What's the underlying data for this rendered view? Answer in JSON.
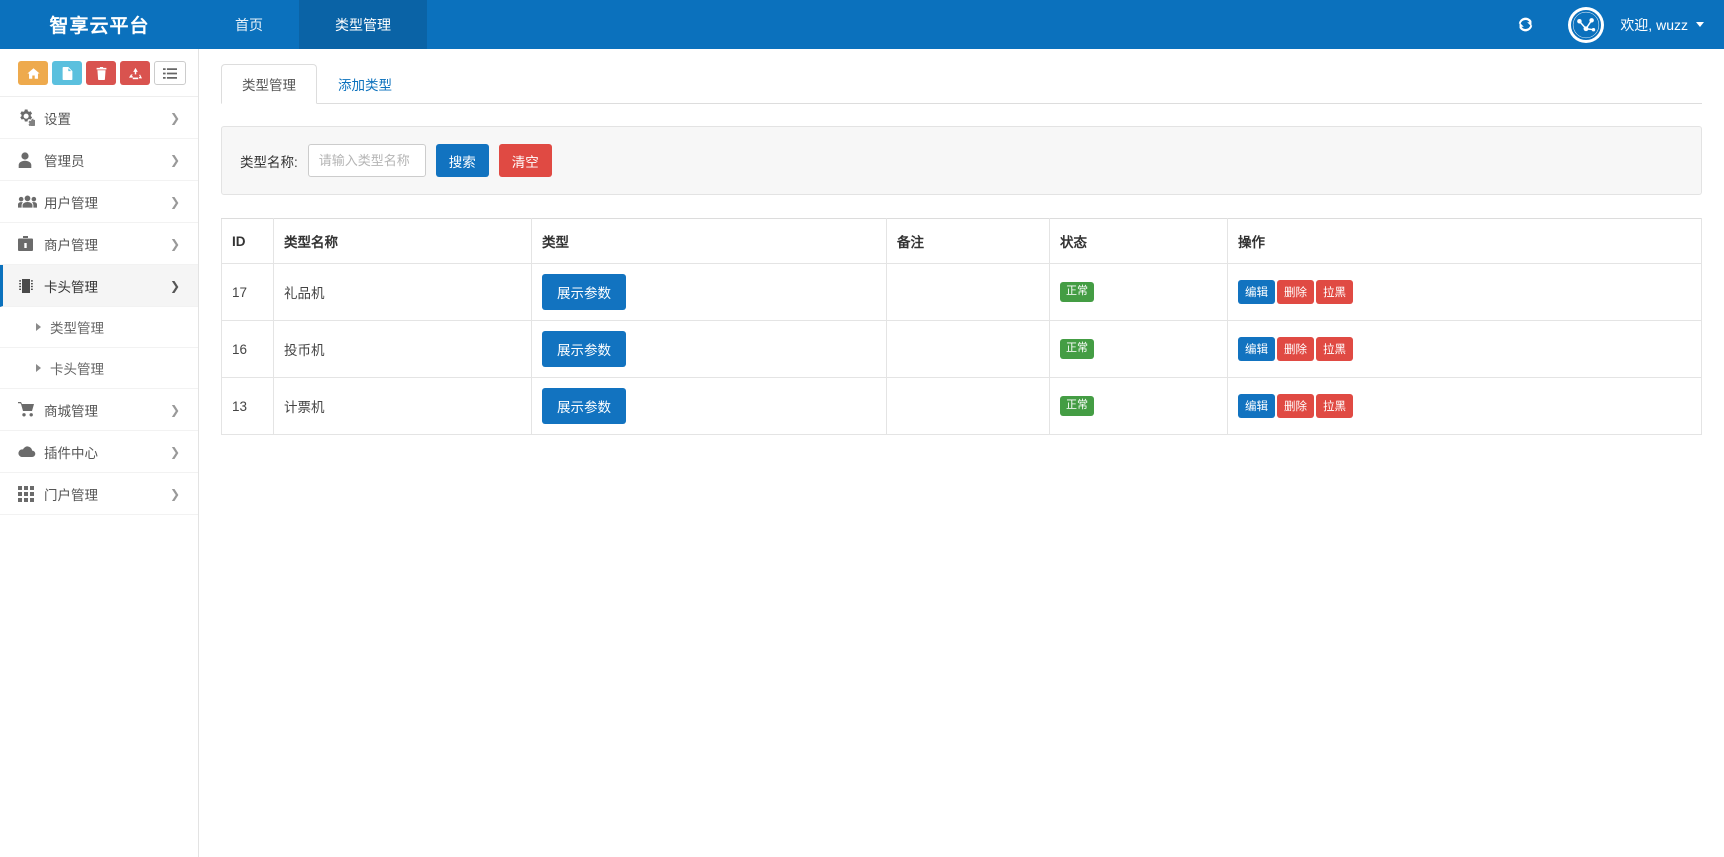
{
  "navbar": {
    "brand": "智享云平台",
    "links": [
      {
        "label": "首页",
        "active": false
      },
      {
        "label": "类型管理",
        "active": true
      }
    ],
    "refresh_icon": "refresh-icon",
    "avatar_icon": "network-globe-icon",
    "welcome": "欢迎, wuzz",
    "accent_color": "#0b71bd",
    "accent_active_color": "#0a63a6"
  },
  "sidebar": {
    "toolbar": [
      {
        "icon": "home-icon",
        "color": "#eeaa4d"
      },
      {
        "icon": "file-icon",
        "color": "#5bc0de"
      },
      {
        "icon": "trash-icon",
        "color": "#d9534f"
      },
      {
        "icon": "recycle-icon",
        "color": "#d9534f"
      },
      {
        "icon": "list-icon",
        "color": "#ffffff"
      }
    ],
    "items": [
      {
        "label": "设置",
        "icon": "gears-icon",
        "active": false
      },
      {
        "label": "管理员",
        "icon": "user-icon",
        "active": false
      },
      {
        "label": "用户管理",
        "icon": "users-icon",
        "active": false
      },
      {
        "label": "商户管理",
        "icon": "briefcase-icon",
        "active": false
      },
      {
        "label": "卡头管理",
        "icon": "chip-icon",
        "active": true
      }
    ],
    "submenu": [
      {
        "label": "类型管理"
      },
      {
        "label": "卡头管理"
      }
    ],
    "items_after": [
      {
        "label": "商城管理",
        "icon": "cart-icon",
        "active": false
      },
      {
        "label": "插件中心",
        "icon": "cloud-icon",
        "active": false
      },
      {
        "label": "门户管理",
        "icon": "grid-icon",
        "active": false
      }
    ]
  },
  "main": {
    "tabs": [
      {
        "label": "类型管理",
        "active": true
      },
      {
        "label": "添加类型",
        "active": false
      }
    ],
    "search": {
      "label": "类型名称:",
      "placeholder": "请输入类型名称",
      "value": "",
      "search_button": "搜索",
      "clear_button": "清空"
    },
    "table": {
      "columns": [
        "ID",
        "类型名称",
        "类型",
        "备注",
        "状态",
        "操作"
      ],
      "rows": [
        {
          "id": "17",
          "name": "礼品机",
          "type_button": "展示参数",
          "remark": "",
          "status": "正常",
          "ops": [
            "编辑",
            "删除",
            "拉黑"
          ]
        },
        {
          "id": "16",
          "name": "投币机",
          "type_button": "展示参数",
          "remark": "",
          "status": "正常",
          "ops": [
            "编辑",
            "删除",
            "拉黑"
          ]
        },
        {
          "id": "13",
          "name": "计票机",
          "type_button": "展示参数",
          "remark": "",
          "status": "正常",
          "ops": [
            "编辑",
            "删除",
            "拉黑"
          ]
        }
      ]
    }
  }
}
